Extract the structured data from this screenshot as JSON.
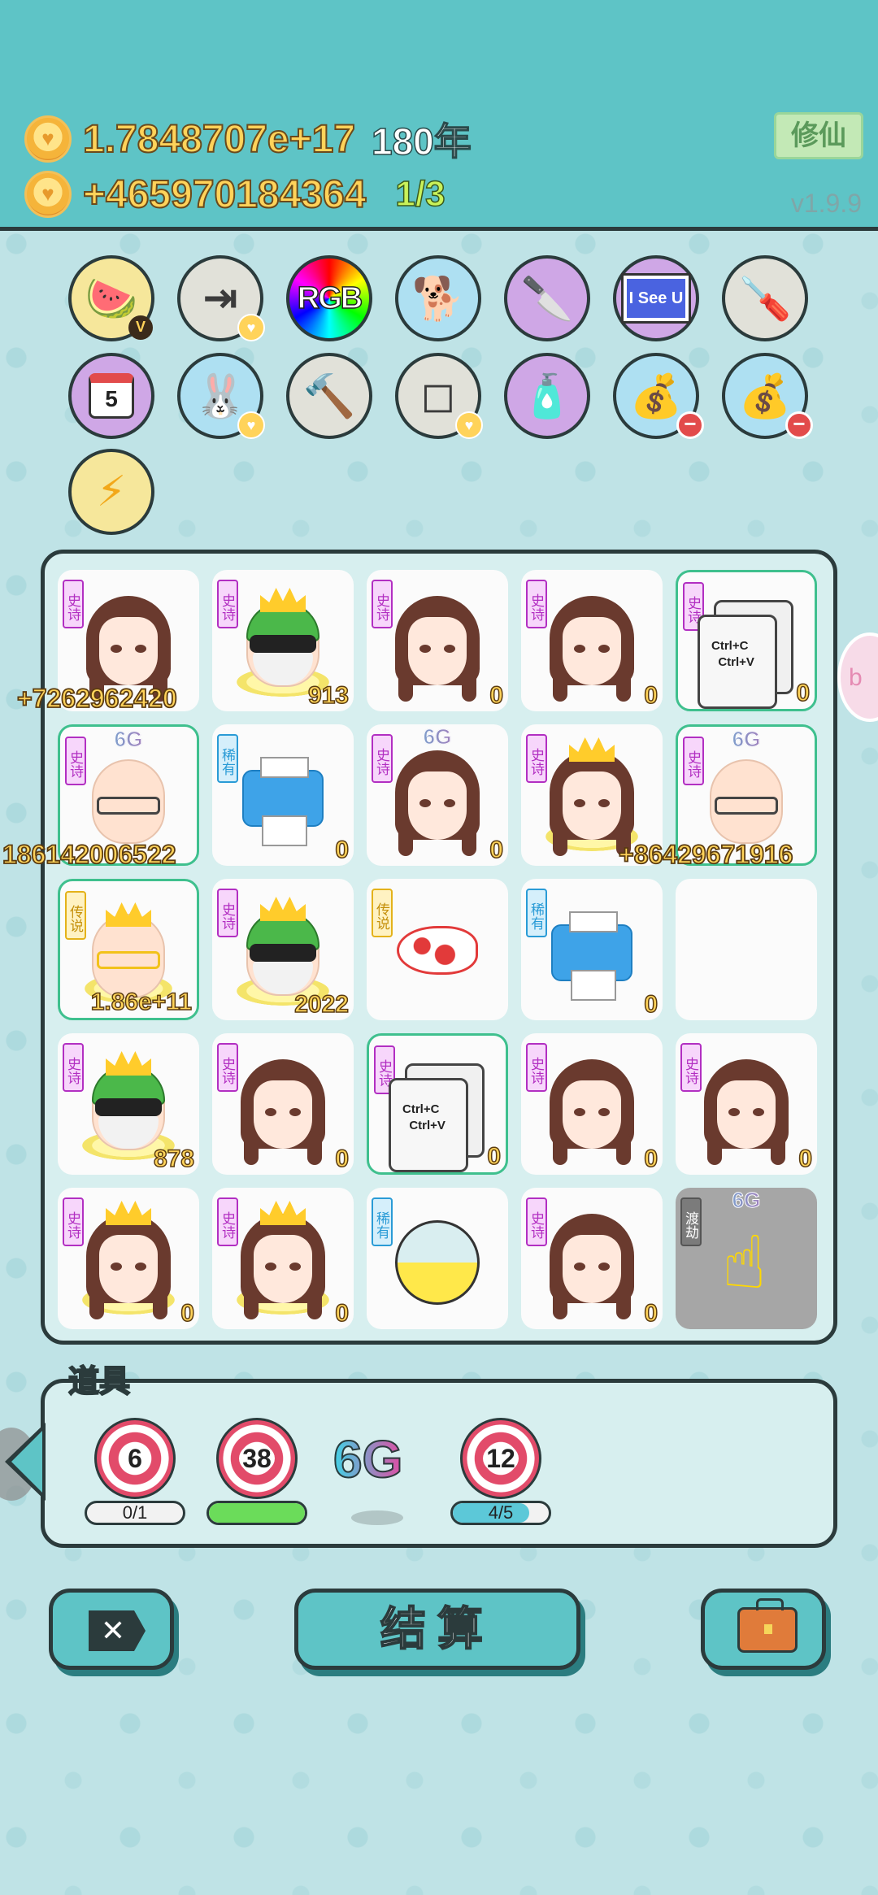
{
  "header": {
    "coins_total": "1.7848707e+17",
    "years": "180年",
    "income": "+465970184364",
    "progress": "1/3",
    "xiuxian_button": "修仙",
    "version": "v1.9.9"
  },
  "item_icons": [
    {
      "name": "fruit-platter-icon",
      "bg": "yellow",
      "badge": "V"
    },
    {
      "name": "skip-arrow-icon",
      "bg": "grey",
      "badge": "heart"
    },
    {
      "name": "rgb-icon",
      "bg": "rgb",
      "text": "RGB"
    },
    {
      "name": "cool-dog-icon",
      "bg": "blue"
    },
    {
      "name": "cleaver-icon",
      "bg": "purple"
    },
    {
      "name": "i-see-u-icon",
      "bg": "purple",
      "text": "I See U"
    },
    {
      "name": "screwdriver-icon",
      "bg": "grey"
    },
    {
      "name": "calendar-icon",
      "bg": "purple",
      "text": "5"
    },
    {
      "name": "rabbit-icon",
      "bg": "blue",
      "badge": "heart"
    },
    {
      "name": "hammer-icon",
      "bg": "grey"
    },
    {
      "name": "sugar-cubes-icon",
      "bg": "grey",
      "badge": "heart"
    },
    {
      "name": "spray-bottle-icon",
      "bg": "purple"
    },
    {
      "name": "money-bag-icon",
      "bg": "blue",
      "badge": "minus"
    },
    {
      "name": "money-bag-icon",
      "bg": "blue",
      "badge": "minus"
    },
    {
      "name": "lightning-icon",
      "bg": "yellow"
    }
  ],
  "board": {
    "tiles": [
      {
        "kind": "girl",
        "tag": "史诗",
        "num": "",
        "six_g": false
      },
      {
        "kind": "king-glasses",
        "tag": "史诗",
        "num": "913"
      },
      {
        "kind": "girl",
        "tag": "史诗",
        "num": "0"
      },
      {
        "kind": "girl",
        "tag": "史诗",
        "num": "0"
      },
      {
        "kind": "copy-paste",
        "tag": "史诗",
        "num": "0",
        "copy_text": "Ctrl+C\nCtrl+V"
      },
      {
        "kind": "old-man",
        "tag": "史诗",
        "num": "",
        "six_g": "6G"
      },
      {
        "kind": "printer",
        "tag": "稀有",
        "num": "0"
      },
      {
        "kind": "girl",
        "tag": "史诗",
        "num": "0",
        "six_g": "6G"
      },
      {
        "kind": "girl-crown",
        "tag": "史诗",
        "num": ""
      },
      {
        "kind": "old-man",
        "tag": "史诗",
        "num": "",
        "six_g": "6G"
      },
      {
        "kind": "king-gold-glasses",
        "tag": "传说",
        "num": "1.86e+11"
      },
      {
        "kind": "king-glasses",
        "tag": "史诗",
        "num": "2022"
      },
      {
        "kind": "fish",
        "tag": "传说",
        "num": ""
      },
      {
        "kind": "printer",
        "tag": "稀有",
        "num": "0"
      },
      {
        "kind": "empty",
        "tag": "",
        "num": ""
      },
      {
        "kind": "king-glasses",
        "tag": "史诗",
        "num": "878"
      },
      {
        "kind": "girl",
        "tag": "史诗",
        "num": "0"
      },
      {
        "kind": "copy-paste",
        "tag": "史诗",
        "num": "0",
        "copy_text": "Ctrl+C\nCtrl+V"
      },
      {
        "kind": "girl",
        "tag": "史诗",
        "num": "0"
      },
      {
        "kind": "girl",
        "tag": "史诗",
        "num": "0"
      },
      {
        "kind": "girl-crown",
        "tag": "史诗",
        "num": "0"
      },
      {
        "kind": "girl-crown",
        "tag": "史诗",
        "num": "0"
      },
      {
        "kind": "gacha-ball",
        "tag": "稀有",
        "num": ""
      },
      {
        "kind": "girl",
        "tag": "史诗",
        "num": "0"
      },
      {
        "kind": "pointer-hand",
        "tag": "渡劫",
        "num": "",
        "six_g": "6G"
      }
    ],
    "floating_numbers": {
      "a": "+7262962420",
      "b": "186142006522",
      "c": "+86429671916"
    }
  },
  "props": {
    "title": "道具",
    "items": [
      {
        "value": "6",
        "bar": "0/1",
        "fill": 0
      },
      {
        "value": "38",
        "bar": "",
        "fill": 1
      },
      {
        "value": "6G",
        "bar": ""
      },
      {
        "value": "12",
        "bar": "4/5",
        "fill": 0.8
      }
    ]
  },
  "buttons": {
    "settle": "结算"
  }
}
